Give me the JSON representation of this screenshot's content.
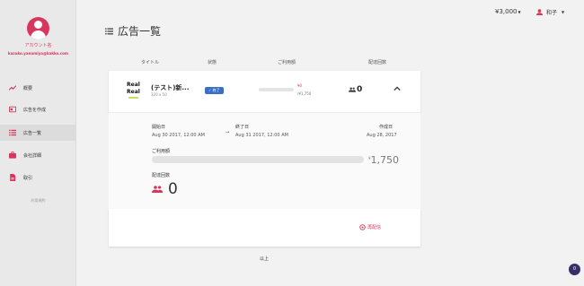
{
  "sidebar": {
    "account_name": "アカウント名",
    "account_email": "kazuko.yanamiya@kakko.com",
    "items": [
      {
        "label": "概要",
        "icon": "trending-icon"
      },
      {
        "label": "広告を作成",
        "icon": "create-ad-icon"
      },
      {
        "label": "広告一覧",
        "icon": "list-icon"
      },
      {
        "label": "会社詳細",
        "icon": "briefcase-icon"
      },
      {
        "label": "取引",
        "icon": "document-icon"
      }
    ],
    "terms": "利用規約"
  },
  "topbar": {
    "balance": "¥3,000",
    "user_name": "和子"
  },
  "page": {
    "title": "広告一覧"
  },
  "columns": {
    "title": "タイトル",
    "status": "状態",
    "usage": "ご利用額",
    "deliveries": "配達回数"
  },
  "ad": {
    "thumb_line1": "Real",
    "thumb_line2": "Real",
    "name": "(テスト)新...",
    "size": "320 x 50",
    "status": "✓ 終了",
    "used": "¥0",
    "budget": "/¥1,750",
    "delivery_count": "0"
  },
  "detail": {
    "start_label": "開始日",
    "start_value": "Aug 30 2017, 12:00 AM",
    "arrow": "→",
    "end_label": "終了日",
    "end_value": "Aug 31 2017, 12:00 AM",
    "created_label": "作成日",
    "created_value": "Aug 28, 2017",
    "usage_label": "ご利用額",
    "usage_currency": "¥",
    "usage_amount": "1,750",
    "deliveries_label": "配達回数",
    "deliveries_value": "0"
  },
  "actions": {
    "redeliver": "再配信"
  },
  "footer": {
    "end_text": "以上",
    "badge_count": "0"
  },
  "colors": {
    "accent": "#d9365d",
    "status_badge": "#3b6fc4",
    "chat_badge": "#3b2d6b"
  },
  "usage_ratio": 0.0
}
